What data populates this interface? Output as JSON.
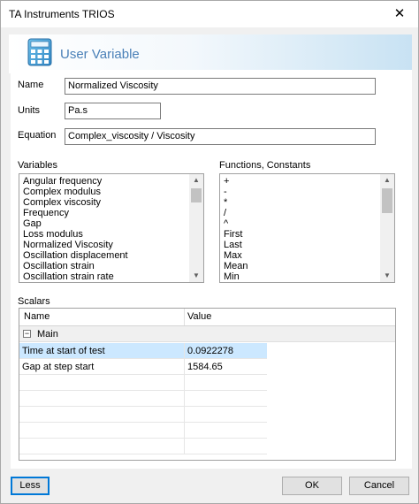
{
  "window": {
    "title": "TA Instruments TRIOS",
    "close_glyph": "✕"
  },
  "header": {
    "title": "User Variable",
    "icon": "calculator-icon"
  },
  "form": {
    "name_label": "Name",
    "name_value": "Normalized Viscosity",
    "units_label": "Units",
    "units_value": "Pa.s",
    "equation_label": "Equation",
    "equation_value": "Complex_viscosity / Viscosity"
  },
  "variables": {
    "label": "Variables",
    "items": [
      "Angular frequency",
      "Complex modulus",
      "Complex viscosity",
      "Frequency",
      "Gap",
      "Loss modulus",
      "Normalized Viscosity",
      "Oscillation displacement",
      "Oscillation strain",
      "Oscillation strain rate"
    ]
  },
  "functions": {
    "label": "Functions, Constants",
    "items": [
      "+",
      "-",
      "*",
      "/",
      "^",
      "First",
      "Last",
      "Max",
      "Mean",
      "Min"
    ]
  },
  "scalars": {
    "label": "Scalars",
    "columns": [
      "Name",
      "Value"
    ],
    "group": "Main",
    "group_toggle": "−",
    "rows": [
      {
        "name": "Time at start of test",
        "value": "0.0922278"
      },
      {
        "name": "Gap at step start",
        "value": "1584.65"
      }
    ]
  },
  "buttons": {
    "less": "Less",
    "ok": "OK",
    "cancel": "Cancel"
  },
  "colors": {
    "header_text": "#4a80b8",
    "selection": "#cce8ff",
    "focus_border": "#0078d7"
  }
}
